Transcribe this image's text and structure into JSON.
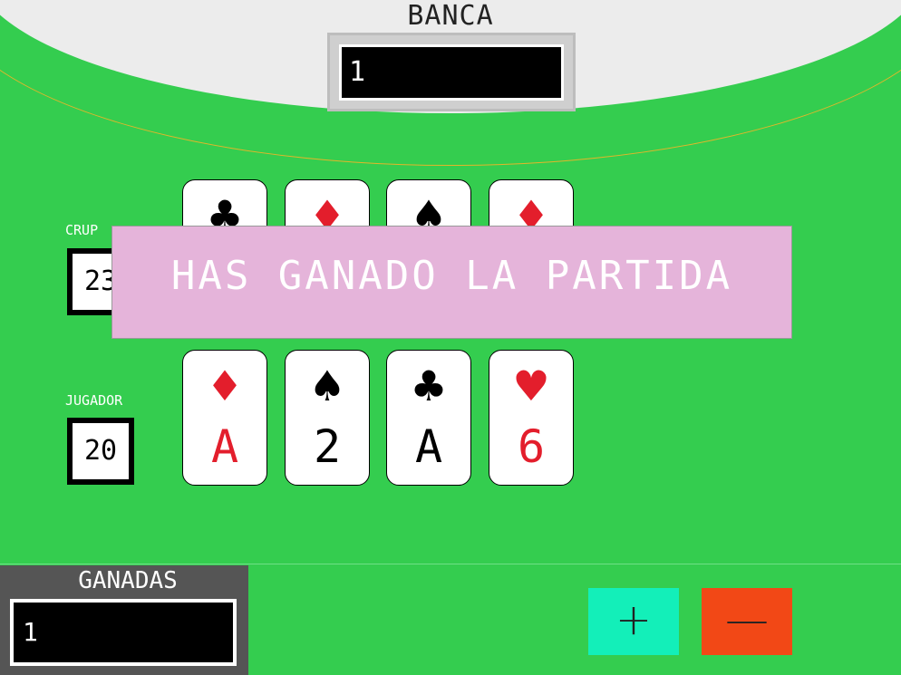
{
  "bank": {
    "label": "BANCA",
    "value": "1"
  },
  "dealer": {
    "label": "CRUP",
    "score": "23"
  },
  "player": {
    "label": "JUGADOR",
    "score": "20"
  },
  "dealer_cards": [
    {
      "suit": "♣",
      "rank": "",
      "color": "black"
    },
    {
      "suit": "♦",
      "rank": "",
      "color": "red"
    },
    {
      "suit": "♠",
      "rank": "",
      "color": "black"
    },
    {
      "suit": "♦",
      "rank": "",
      "color": "red"
    }
  ],
  "player_cards": [
    {
      "suit": "♦",
      "rank": "A",
      "color": "red"
    },
    {
      "suit": "♠",
      "rank": "2",
      "color": "black"
    },
    {
      "suit": "♣",
      "rank": "A",
      "color": "black"
    },
    {
      "suit": "♥",
      "rank": "6",
      "color": "red"
    }
  ],
  "message": "HAS GANADO LA PARTIDA",
  "wins": {
    "label": "GANADAS",
    "value": "1"
  },
  "buttons": {
    "plus": "+",
    "minus": "—"
  },
  "colors": {
    "table": "#34cd4f",
    "banner": "#e5b4da",
    "plus": "#13efb9",
    "minus": "#f24816"
  }
}
